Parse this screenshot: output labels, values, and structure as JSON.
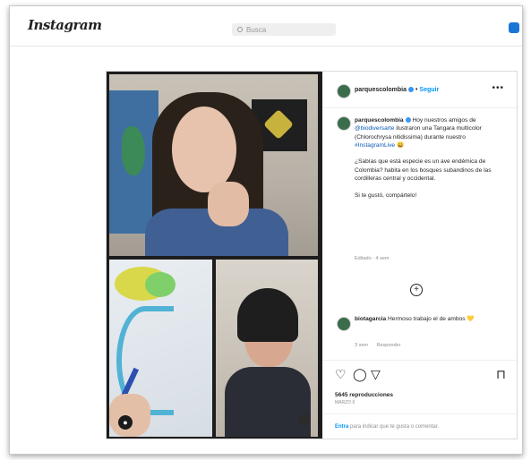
{
  "app": {
    "logo": "Instagram",
    "search_placeholder": "Busca"
  },
  "post": {
    "username": "parquescolombia",
    "follow_label": "Seguir",
    "caption_user": "parquescolombia",
    "caption_1": "Hoy nuestros amigos de",
    "caption_mention": "@biodiversarte",
    "caption_2": "ilustraron una Tangara multicolor (Chlorochrysa nitidissima) durante nuestro",
    "caption_hashtag": "#InstagramLive",
    "caption_3": "¿Sabías que está especie es un ave endémica de Colombia? habita en los bosques subandinos de las cordilleras central y occidental.",
    "caption_4": "Si te gustó, compártelo!",
    "caption_meta": "Editado · 4 sem",
    "comment": {
      "user": "biotagarcia",
      "text": "Hermoso trabajo el de ambos 💛",
      "time": "3 sem",
      "reply_label": "Responder"
    },
    "views": "5645 reproducciones",
    "date": "MARZO 6",
    "footer_link": "Entra",
    "footer_text": "para indicar que te gusta o comentar."
  },
  "icons": [
    "search-icon",
    "app-icon",
    "verified-badge-icon",
    "more-icon",
    "add-icon",
    "heart-icon",
    "comment-icon",
    "share-icon",
    "bookmark-icon",
    "user-icon",
    "mic-icon"
  ],
  "colors": {
    "link": "#0095f6",
    "verified": "#3897f0",
    "text": "#262626",
    "muted": "#8e8e8e"
  }
}
